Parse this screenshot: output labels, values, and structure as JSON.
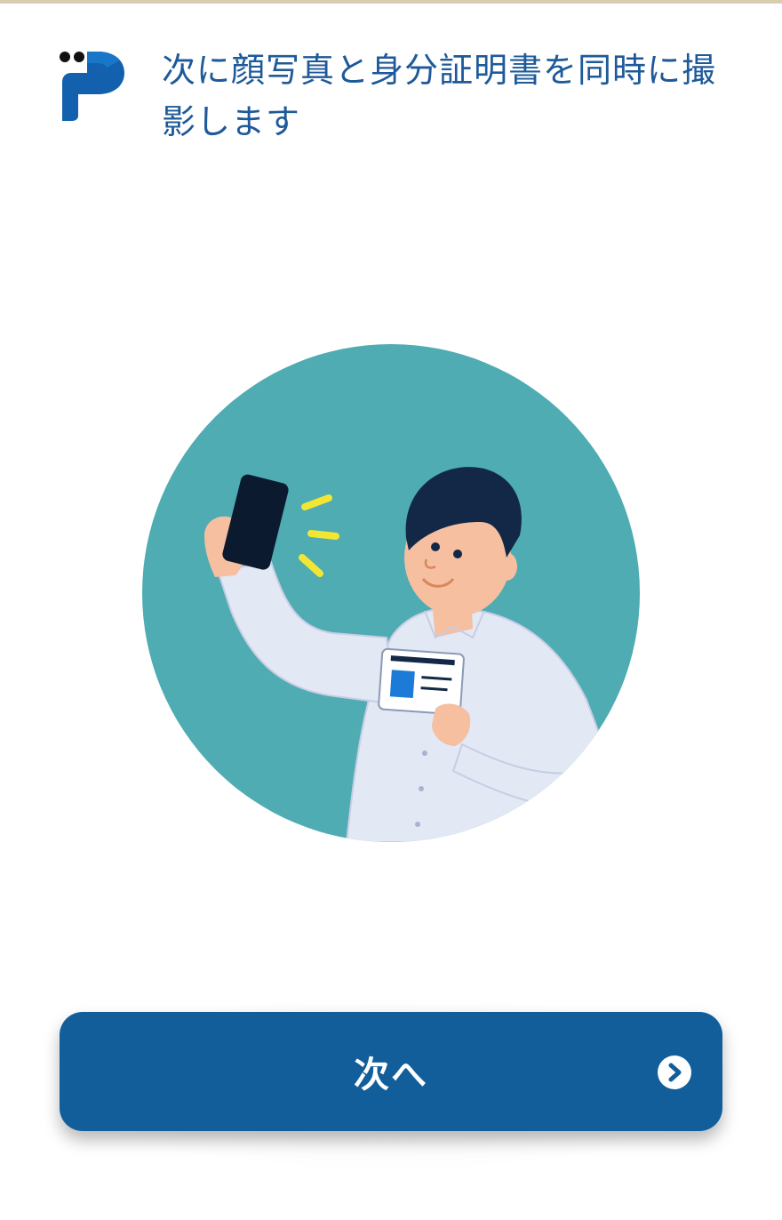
{
  "header": {
    "logo": "p-logo-icon",
    "title": "次に顔写真と身分証明書を同時に撮影します"
  },
  "illustration": {
    "name": "selfie-with-id-card-illustration",
    "background_color": "#4eacb2"
  },
  "next_button": {
    "label": "次へ",
    "icon": "chevron-right-circle-icon",
    "color": "#125e9b"
  },
  "colors": {
    "accent": "#125e9b",
    "title_text": "#1e5a99"
  }
}
